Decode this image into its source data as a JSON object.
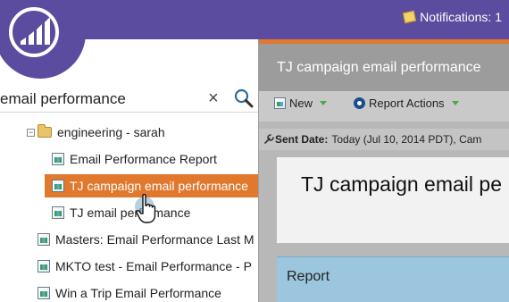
{
  "header": {
    "notifications_label": "Notifications: 1",
    "logo_icon": "marketo-logo-icon",
    "bar_color": "#5c4c9f"
  },
  "search": {
    "value": "email performance",
    "clear_icon": "×",
    "search_icon": "search-icon"
  },
  "tree": {
    "folder": {
      "label": "engineering - sarah",
      "expander": "−"
    },
    "items": [
      {
        "label": "Email Performance Report",
        "icon": "report-icon"
      },
      {
        "label": "TJ campaign email performance",
        "icon": "report-icon",
        "selected": true
      },
      {
        "label": "TJ email performance",
        "icon": "report-icon"
      },
      {
        "label": "Masters: Email Performance Last M",
        "icon": "report-icon"
      },
      {
        "label": "MKTO test - Email Performance - P",
        "icon": "report-icon"
      },
      {
        "label": "Win a Trip Email Performance",
        "icon": "report-icon"
      }
    ],
    "selected_color": "#e0782d"
  },
  "right_panel": {
    "title": "TJ campaign email performance",
    "toolbar": {
      "new_label": "New",
      "report_actions_label": "Report Actions"
    },
    "sent_date": {
      "label": "Sent Date:",
      "value": "Today (Jul 10, 2014 PDT), Cam"
    },
    "card_title": "TJ campaign email pe",
    "section_label": "Report",
    "accent_color": "#e0782d"
  }
}
